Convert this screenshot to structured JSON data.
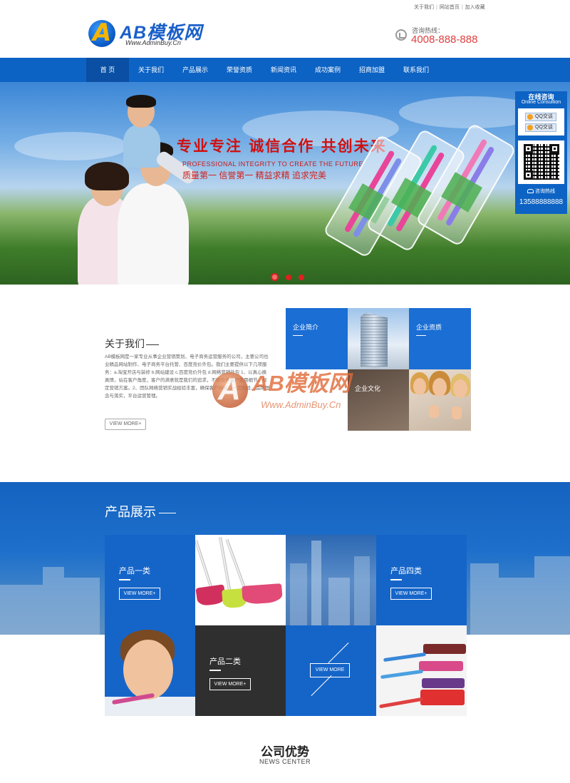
{
  "topbar": {
    "links": [
      "关于我们",
      "网站首页",
      "加入收藏"
    ]
  },
  "logo": {
    "text": "AB模板网",
    "sub": "Www.AdminBuy.Cn"
  },
  "hotline": {
    "label": "咨询热线：",
    "number": "4008-888-888"
  },
  "nav": {
    "items": [
      "首 页",
      "关于我们",
      "产品展示",
      "荣誉资质",
      "新闻资讯",
      "成功案例",
      "招商加盟",
      "联系我们"
    ],
    "active_index": 0
  },
  "banner": {
    "slogan": "专业专注 诚信合作 共创未来",
    "slogan_en": "PROFESSIONAL INTEGRITY TO CREATE THE FUTURE",
    "slogan_sub": "质量第一 信誉第一 精益求精 追求完美",
    "slides": 3,
    "active_slide": 0
  },
  "float_panel": {
    "title": "在线咨询",
    "subtitle": "Online Consultion",
    "qq_buttons": [
      "QQ交谈",
      "QQ交谈"
    ],
    "hotline_label": "咨询热线",
    "hotline_number": "13588888888"
  },
  "about": {
    "title": "关于我们",
    "text": "AB模板网是一家专业从事企业营销策划、电子商务运营服务的公司，主要公司也业精品网站制作、电子商务平台托管、百度竞价外包。我们主要提供以下几项服务：a.淘宝开店与装修 b.网站建设 c.百度竞价外包 d.网络营销外包 1、以真心换真情，站在客户角度，客户的满意就是我们的追求，不断培养客户使用细节。规定营销方案。2、团队网络营销实战经验丰富，确保客户网站在一定阶段，品牌理念与落实，平台运营管理。",
    "button": "VIEW MORE+",
    "tiles": [
      "企业简介",
      "企业资质",
      "企业文化"
    ]
  },
  "watermark": {
    "text": "AB模板网",
    "sub": "Www.AdminBuy.Cn"
  },
  "products": {
    "title": "产品展示",
    "cats": [
      {
        "label": "产品一类",
        "button": "VIEW MORE+"
      },
      {
        "label": "产品四类",
        "button": "VIEW MORE+"
      },
      {
        "label": "产品二类",
        "button": "VIEW MORE+"
      }
    ],
    "center_button": "VIEW MORE"
  },
  "advantages": {
    "title": "公司优势",
    "subtitle": "NEWS CENTER"
  },
  "colors": {
    "brand_blue": "#0d63c4",
    "nav_active": "#0a4fa3",
    "hotline_red": "#e04040",
    "dark_tile": "#2f2f2f"
  }
}
